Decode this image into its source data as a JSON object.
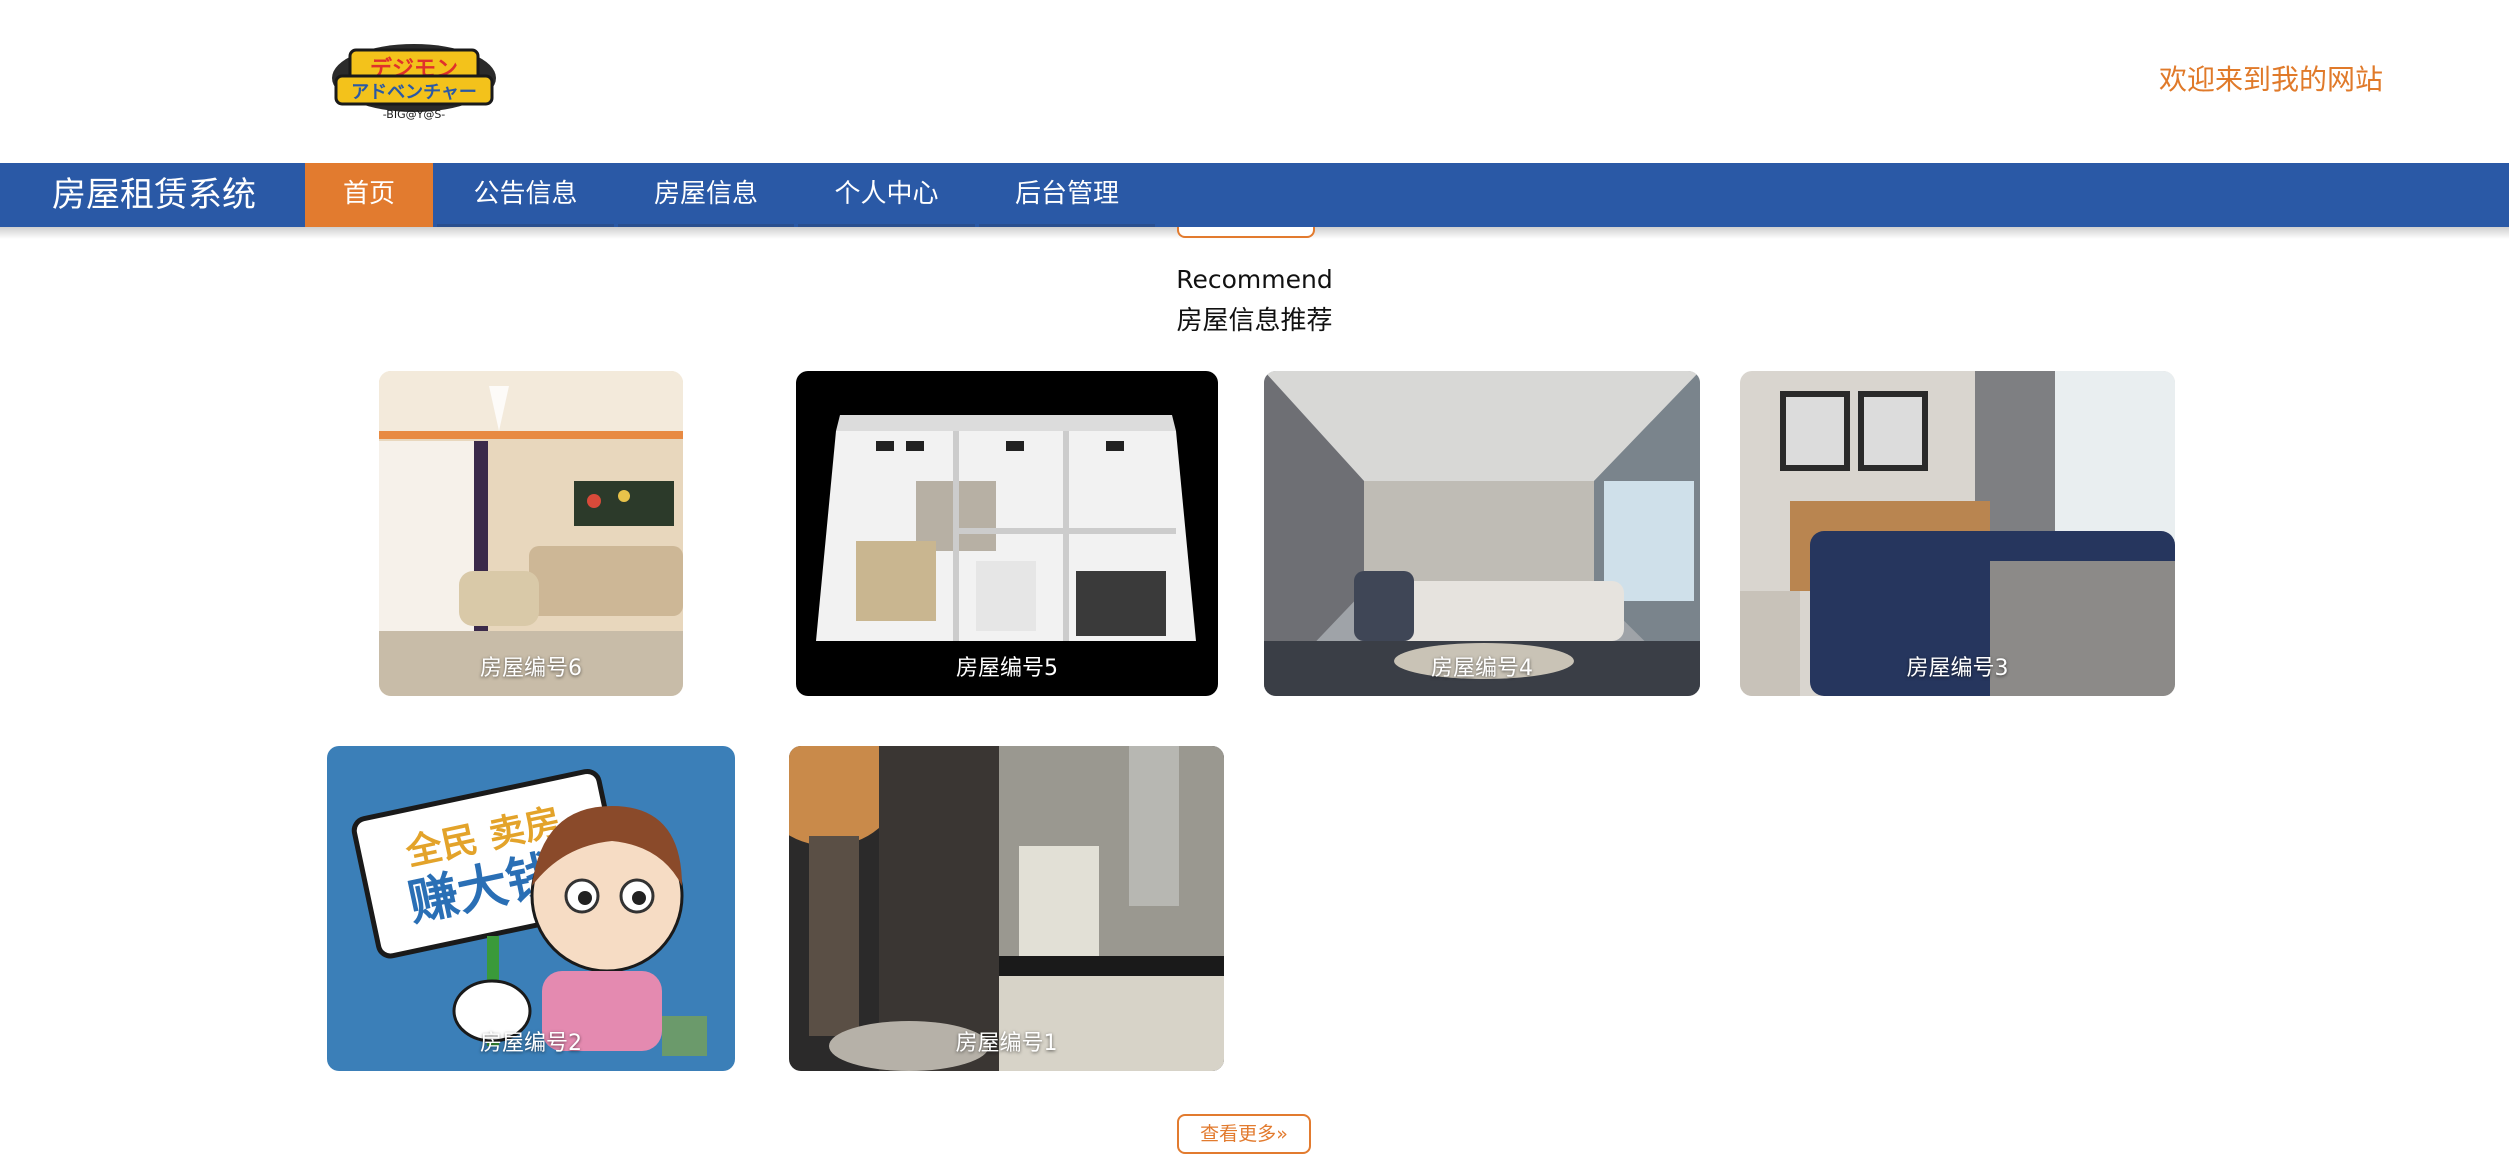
{
  "header": {
    "logo_text_top": "デジモン",
    "logo_text_mid": "アドベンチャー",
    "logo_text_sub": "-BIG@Y@S-",
    "welcome": "欢迎来到我的网站"
  },
  "nav": {
    "brand": "房屋租赁系统",
    "items": [
      {
        "label": "首页",
        "active": true
      },
      {
        "label": "公告信息"
      },
      {
        "label": "房屋信息"
      },
      {
        "label": "个人中心"
      },
      {
        "label": "后台管理"
      }
    ]
  },
  "section": {
    "title_en": "Recommend",
    "title_cn": "房屋信息推荐"
  },
  "cards": [
    {
      "label": "房屋编号6",
      "image": "living-room-photo"
    },
    {
      "label": "房屋编号5",
      "image": "floor-plan-3d"
    },
    {
      "label": "房屋编号4",
      "image": "living-room-photo"
    },
    {
      "label": "房屋编号3",
      "image": "bedroom-photo"
    },
    {
      "label": "房屋编号2",
      "image": "cartoon-sign",
      "sign_line1": "全民 卖房",
      "sign_line2": "赚大钱!"
    },
    {
      "label": "房屋编号1",
      "image": "kitchen-photo"
    }
  ],
  "more_button": {
    "label": "查看更多",
    "icon": "double-chevron-right-icon"
  },
  "colors": {
    "nav_bg": "#2a59a6",
    "accent": "#e27b2f",
    "welcome": "#e07a2a"
  }
}
